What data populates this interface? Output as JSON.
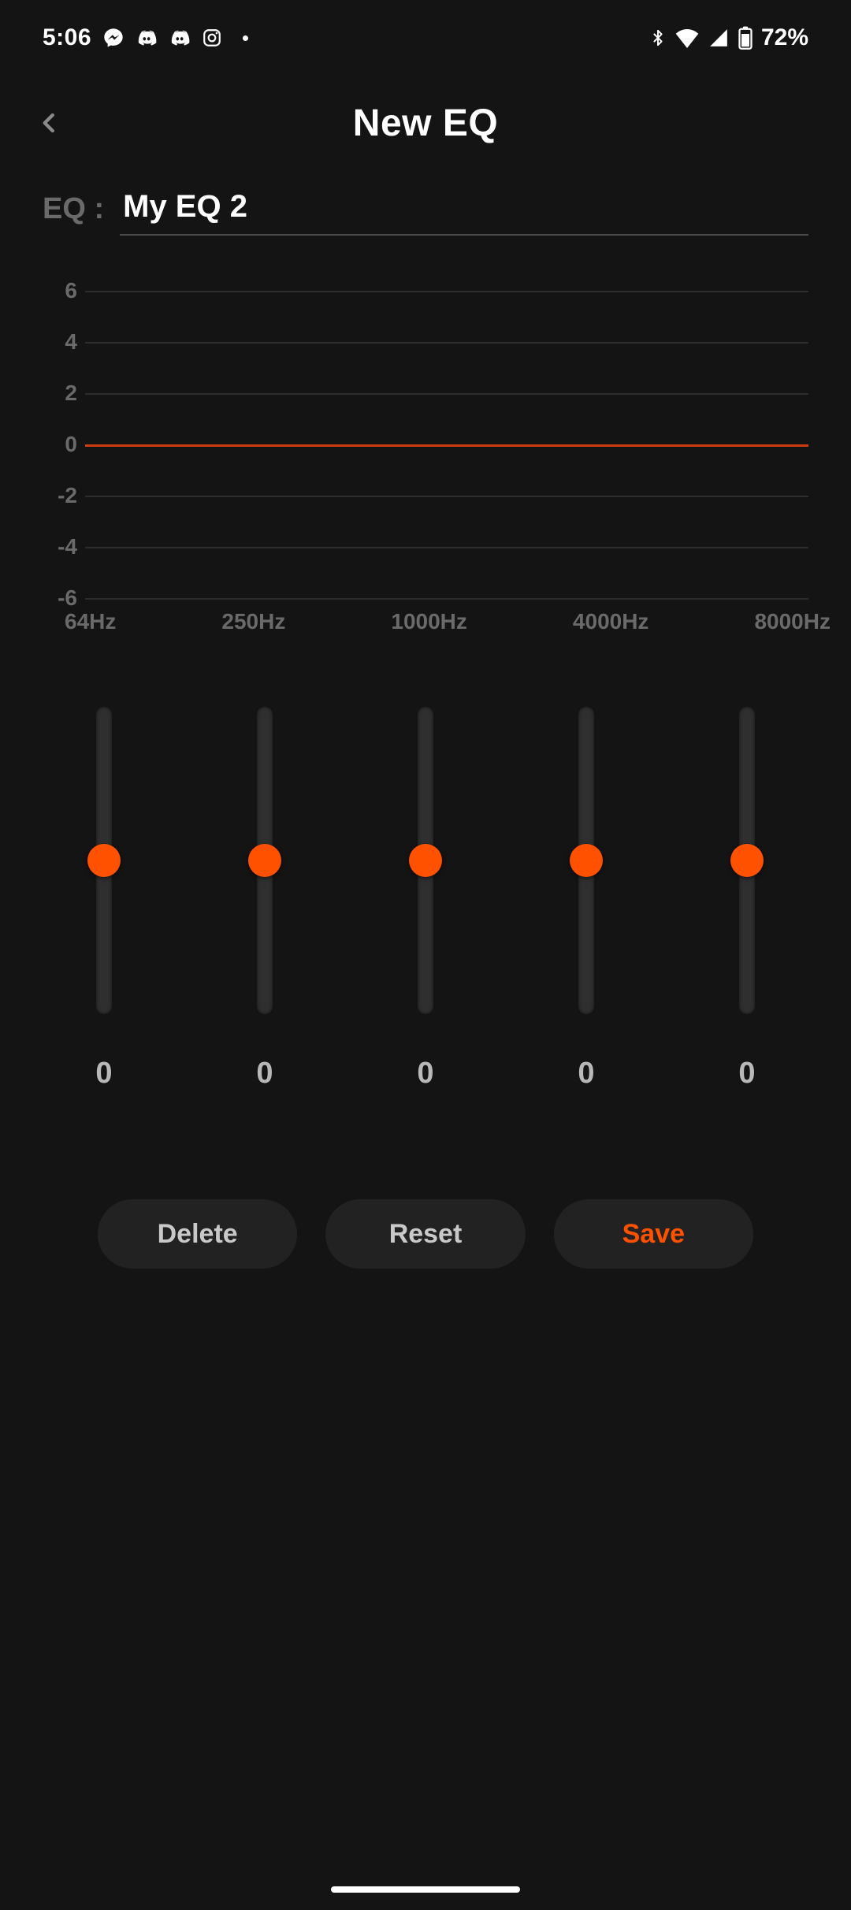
{
  "status": {
    "time": "5:06",
    "battery_pct": "72%"
  },
  "header": {
    "title": "New EQ"
  },
  "name": {
    "label": "EQ :",
    "value": "My EQ 2"
  },
  "chart_data": {
    "type": "line",
    "title": "",
    "xlabel": "",
    "ylabel": "",
    "ylim": [
      -6,
      6
    ],
    "y_ticks": [
      6,
      4,
      2,
      0,
      -2,
      -4,
      -6
    ],
    "categories": [
      "64Hz",
      "250Hz",
      "1000Hz",
      "4000Hz",
      "8000Hz"
    ],
    "values": [
      0,
      0,
      0,
      0,
      0
    ]
  },
  "sliders": [
    {
      "band": "64Hz",
      "value": 0,
      "display": "0"
    },
    {
      "band": "250Hz",
      "value": 0,
      "display": "0"
    },
    {
      "band": "1000Hz",
      "value": 0,
      "display": "0"
    },
    {
      "band": "4000Hz",
      "value": 0,
      "display": "0"
    },
    {
      "band": "8000Hz",
      "value": 0,
      "display": "0"
    }
  ],
  "buttons": {
    "delete": "Delete",
    "reset": "Reset",
    "save": "Save"
  },
  "colors": {
    "accent": "#ff5100",
    "bg": "#141414",
    "btn_bg": "#222222",
    "muted": "#6a6a6a"
  }
}
